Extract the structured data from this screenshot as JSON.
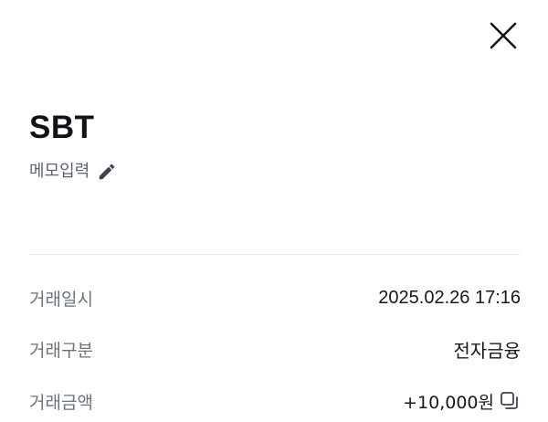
{
  "header": {
    "close_icon": "close-icon"
  },
  "merchant": {
    "name": "SBT",
    "memo_label": "메모입력",
    "memo_icon": "pencil-icon"
  },
  "details": [
    {
      "label": "거래일시",
      "value": "2025.02.26 17:16"
    },
    {
      "label": "거래구분",
      "value": "전자금융"
    },
    {
      "label": "거래금액",
      "value": "+10,000원",
      "icon": "copy-icon"
    }
  ],
  "colors": {
    "text_primary": "#111317",
    "text_secondary": "#6a727c",
    "divider": "#e9ebee",
    "background": "#ffffff"
  }
}
